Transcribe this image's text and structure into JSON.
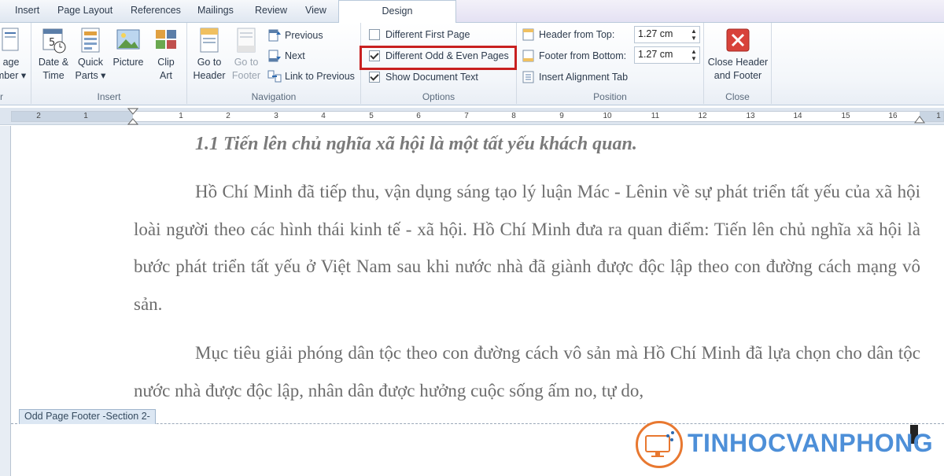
{
  "tabs": {
    "insert": "Insert",
    "page_layout": "Page Layout",
    "references": "References",
    "mailings": "Mailings",
    "review": "Review",
    "view": "View",
    "design": "Design"
  },
  "ribbon": {
    "header_footer": {
      "page_number_line1": "age",
      "page_number_line2": "mber ▾",
      "label": "r"
    },
    "insert": {
      "label": "Insert",
      "date_time_line1": "Date &",
      "date_time_line2": "Time",
      "quick_parts_line1": "Quick",
      "quick_parts_line2": "Parts ▾",
      "picture": "Picture",
      "clip_art_line1": "Clip",
      "clip_art_line2": "Art"
    },
    "navigation": {
      "label": "Navigation",
      "goto_header_line1": "Go to",
      "goto_header_line2": "Header",
      "goto_footer_line1": "Go to",
      "goto_footer_line2": "Footer",
      "previous": "Previous",
      "next": "Next",
      "link_to_previous": "Link to Previous"
    },
    "options": {
      "label": "Options",
      "different_first_page": "Different First Page",
      "different_first_page_checked": false,
      "different_odd_even": "Different Odd & Even Pages",
      "different_odd_even_checked": true,
      "show_document_text": "Show Document Text",
      "show_document_text_checked": true
    },
    "position": {
      "label": "Position",
      "header_from_top_label": "Header from Top:",
      "header_from_top_value": "1.27 cm",
      "footer_from_bottom_label": "Footer from Bottom:",
      "footer_from_bottom_value": "1.27 cm",
      "insert_alignment_tab": "Insert Alignment Tab"
    },
    "close": {
      "label": "Close",
      "close_line1": "Close Header",
      "close_line2": "and Footer"
    }
  },
  "ruler": {
    "left_numbers": [
      "2",
      "1"
    ],
    "right_numbers": [
      "1",
      "2",
      "3",
      "4",
      "5",
      "6",
      "7",
      "8",
      "9",
      "10",
      "11",
      "12",
      "13",
      "14",
      "15",
      "16",
      "1"
    ]
  },
  "document": {
    "heading": "1.1 Tiến lên chủ nghĩa xã hội là một tất yếu khách quan.",
    "paragraph1": "Hồ Chí Minh đã tiếp thu, vận dụng sáng tạo lý luận Mác - Lênin về sự phát triển tất yếu của xã hội loài người theo các hình thái kinh tế - xã hội. Hồ Chí Minh đưa ra quan điểm: Tiến lên chủ nghĩa xã hội là bước phát triển tất yếu ở Việt Nam sau khi nước nhà đã giành được độc lập theo con đường cách mạng vô sản.",
    "paragraph2": "Mục tiêu giải phóng dân tộc theo con đường cách vô sản mà Hồ Chí Minh đã lựa chọn cho dân tộc nước nhà được độc lập, nhân dân được hưởng cuộc sống ấm no, tự do,",
    "footer_tag": "Odd Page Footer -Section 2-"
  },
  "watermark": {
    "text": "TINHOCVANPHONG"
  }
}
